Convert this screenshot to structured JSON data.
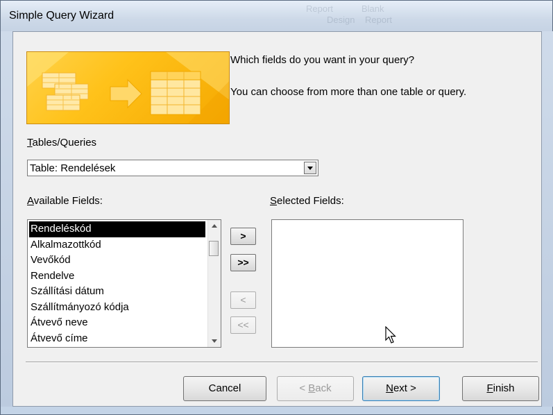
{
  "window": {
    "title": "Simple Query Wizard"
  },
  "background_titlebar": [
    "Report",
    "Blank",
    "Design",
    "Report"
  ],
  "prompt": {
    "question": "Which fields do you want in your query?",
    "hint": "You can choose from more than one table or query."
  },
  "tables_queries": {
    "label_underlined": "T",
    "label_rest": "ables/Queries",
    "selected": "Table: Rendelések"
  },
  "available": {
    "label_underlined": "A",
    "label_rest": "vailable Fields:",
    "items": [
      "Rendeléskód",
      "Alkalmazottkód",
      "Vevőkód",
      "Rendelve",
      "Szállítási dátum",
      "Szállítmányozó kódja",
      "Átvevő neve",
      "Átvevő címe"
    ],
    "selected_index": 0
  },
  "selected_fields": {
    "label_underlined": "S",
    "label_rest": "elected Fields:",
    "items": []
  },
  "move_buttons": {
    "add_one": ">",
    "add_all": ">>",
    "remove_one": "<",
    "remove_all": "<<"
  },
  "buttons": {
    "cancel": "Cancel",
    "back_prefix": "< ",
    "back_underlined": "B",
    "back_rest": "ack",
    "next_underlined": "N",
    "next_rest": "ext >",
    "finish_underlined": "F",
    "finish_rest": "inish"
  },
  "colors": {
    "banner": "#ffc21a",
    "selection": "#000000",
    "default_button_border": "#3c7fb1"
  },
  "icons": [
    "dropdown-arrow-icon",
    "scroll-up-icon",
    "scroll-down-icon",
    "mouse-pointer-icon",
    "wizard-banner-graphic"
  ]
}
